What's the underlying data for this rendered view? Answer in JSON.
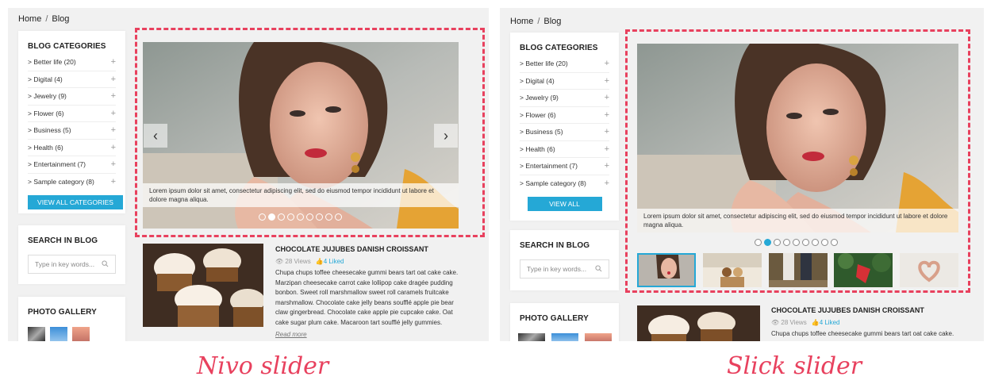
{
  "breadcrumb": {
    "home": "Home",
    "separator": "/",
    "current": "Blog"
  },
  "categories": {
    "title": "BLOG CATEGORIES",
    "items": [
      {
        "label": "> Better life (20)"
      },
      {
        "label": "> Digital (4)"
      },
      {
        "label": "> Jewelry (9)"
      },
      {
        "label": "> Flower (6)"
      },
      {
        "label": "> Business (5)"
      },
      {
        "label": "> Health (6)"
      },
      {
        "label": "> Entertainment (7)"
      },
      {
        "label": "> Sample category (8)"
      }
    ],
    "plus": "+",
    "view_all": "VIEW ALL CATEGORIES"
  },
  "search": {
    "title": "SEARCH IN BLOG",
    "placeholder": "Type in key words..."
  },
  "gallery": {
    "title": "PHOTO GALLERY"
  },
  "slider": {
    "caption": "Lorem ipsum dolor sit amet, consectetur adipiscing elit, sed do eiusmod tempor incididunt ut labore et dolore magna aliqua.",
    "prev": "‹",
    "next": "›",
    "dot_count": 9,
    "left_active_dot": 2,
    "right_active_dot": 2
  },
  "post": {
    "title": "CHOCOLATE JUJUBES DANISH CROISSANT",
    "views": "28 Views",
    "likes": "4 Liked",
    "excerpt_full": "Chupa chups toffee cheesecake gummi bears tart oat cake cake. Marzipan cheesecake carrot cake lollipop cake dragée pudding bonbon. Sweet roll marshmallow sweet roll caramels fruitcake marshmallow. Chocolate cake jelly beans soufflé apple pie bear claw gingerbread. Chocolate cake apple pie cupcake cake. Oat cake sugar plum cake. Macaroon tart soufflé jelly gummies.",
    "excerpt_short": "Chupa chups toffee cheesecake gummi bears tart oat cake cake.",
    "read_more": "Read more"
  },
  "labels": {
    "left": "Nivo slider",
    "right": "Slick slider"
  },
  "colors": {
    "accent": "#25a8d6",
    "highlight": "#e8415e",
    "panel_bg": "#f1f1f1"
  }
}
